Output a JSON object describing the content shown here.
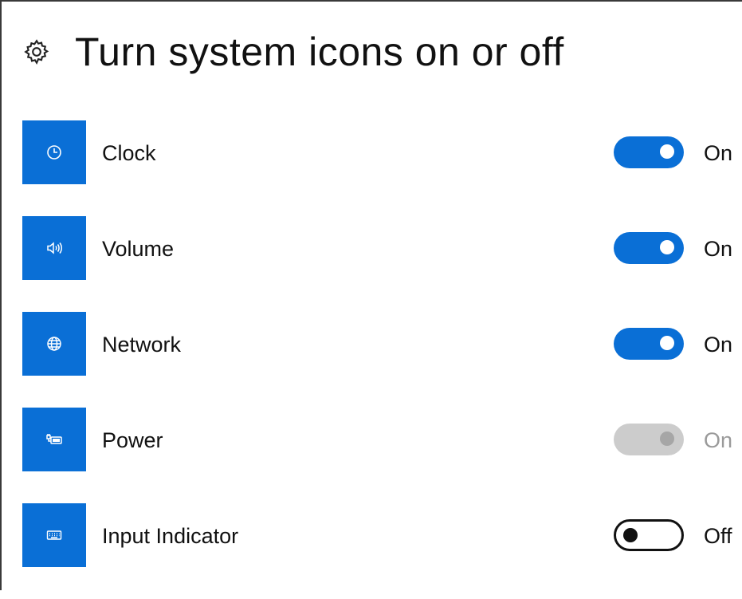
{
  "page": {
    "title": "Turn system icons on or off",
    "icon": "gear-icon"
  },
  "colors": {
    "accent": "#0a6fd6",
    "disabled": "#cccccc",
    "text": "#111111"
  },
  "items": [
    {
      "label": "Clock",
      "icon": "clock-icon",
      "state": "On",
      "toggle": "on"
    },
    {
      "label": "Volume",
      "icon": "volume-icon",
      "state": "On",
      "toggle": "on"
    },
    {
      "label": "Network",
      "icon": "network-globe-icon",
      "state": "On",
      "toggle": "on"
    },
    {
      "label": "Power",
      "icon": "power-battery-icon",
      "state": "On",
      "toggle": "disabled"
    },
    {
      "label": "Input Indicator",
      "icon": "keyboard-icon",
      "state": "Off",
      "toggle": "off"
    }
  ]
}
